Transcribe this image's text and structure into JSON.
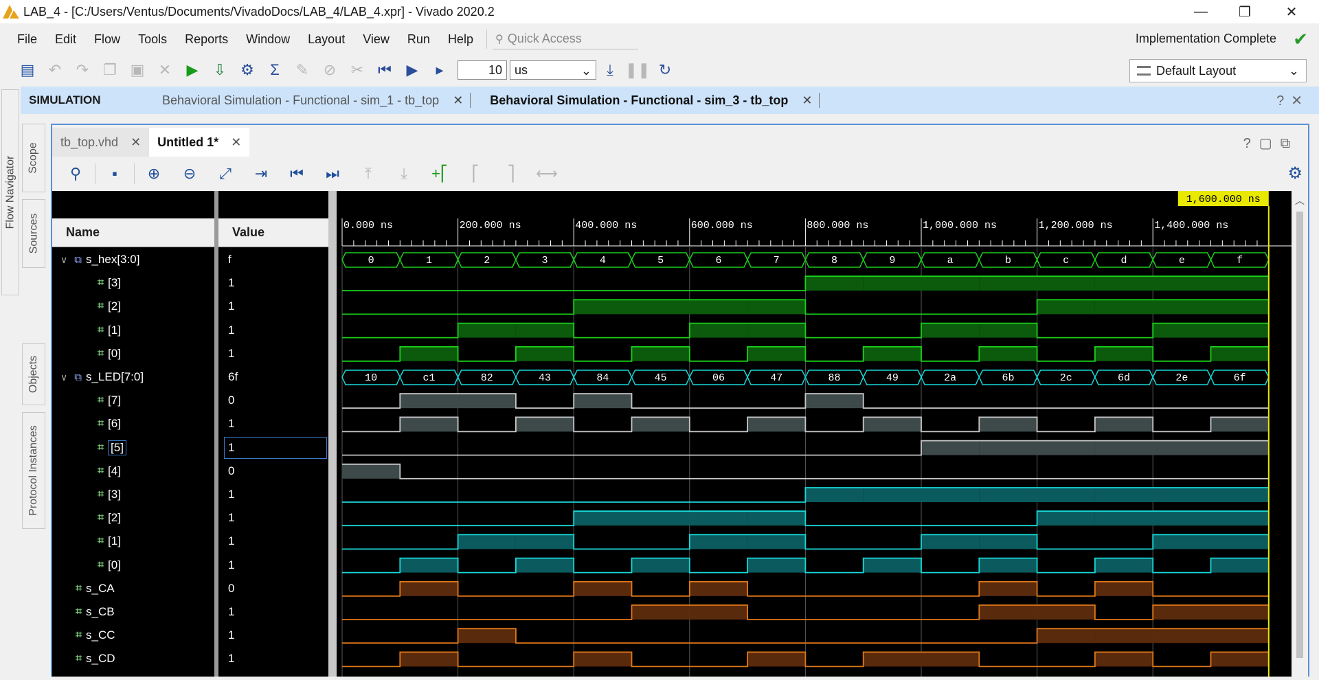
{
  "window": {
    "title": "LAB_4 - [C:/Users/Ventus/Documents/VivadoDocs/LAB_4/LAB_4.xpr] - Vivado 2020.2",
    "minimize": "—",
    "restore": "❐",
    "close": "✕"
  },
  "menu": {
    "items": [
      "File",
      "Edit",
      "Flow",
      "Tools",
      "Reports",
      "Window",
      "Layout",
      "View",
      "Run",
      "Help"
    ],
    "quick_access_placeholder": "Quick Access",
    "status": "Implementation Complete",
    "status_color": "#2a9a2a"
  },
  "toolbar": {
    "run_time_value": "10",
    "run_time_unit": "us",
    "layout": "Default Layout"
  },
  "sim_bar": {
    "label": "SIMULATION",
    "tabs": [
      {
        "label": "Behavioral Simulation - Functional - sim_1 - tb_top",
        "active": false
      },
      {
        "label": "Behavioral Simulation - Functional - sim_3 - tb_top",
        "active": true
      }
    ]
  },
  "side_tabs": {
    "left": [
      "Flow Navigator"
    ],
    "inner": [
      "Scope",
      "Sources",
      "Objects",
      "Protocol Instances"
    ]
  },
  "editor_tabs": [
    {
      "label": "tb_top.vhd",
      "active": false
    },
    {
      "label": "Untitled 1*",
      "active": true
    }
  ],
  "wave": {
    "header_name": "Name",
    "header_value": "Value",
    "cursor_time": "1,600.000 ns",
    "ticks": [
      "0.000 ns",
      "200.000 ns",
      "400.000 ns",
      "600.000 ns",
      "800.000 ns",
      "1,000.000 ns",
      "1,200.000 ns",
      "1,400.000 ns"
    ],
    "colors": {
      "green": "#1ad01a",
      "green_fill": "#0c5a0c",
      "gray": "#c8c8c8",
      "gray_fill": "#3e4a4a",
      "cyan": "#18d8d8",
      "cyan_fill": "#0b5a5e",
      "orange": "#e07818",
      "orange_fill": "#5a2a0c",
      "cursor": "#e8e800"
    },
    "signals": [
      {
        "name": "s_hex[3:0]",
        "value": "f",
        "kind": "bus",
        "level": 0,
        "color": "green",
        "bus_values": [
          "0",
          "1",
          "2",
          "3",
          "4",
          "5",
          "6",
          "7",
          "8",
          "9",
          "a",
          "b",
          "c",
          "d",
          "e",
          "f"
        ]
      },
      {
        "name": "[3]",
        "value": "1",
        "kind": "bit",
        "level": 1,
        "color": "green",
        "bits": [
          0,
          0,
          0,
          0,
          0,
          0,
          0,
          0,
          1,
          1,
          1,
          1,
          1,
          1,
          1,
          1
        ]
      },
      {
        "name": "[2]",
        "value": "1",
        "kind": "bit",
        "level": 1,
        "color": "green",
        "bits": [
          0,
          0,
          0,
          0,
          1,
          1,
          1,
          1,
          0,
          0,
          0,
          0,
          1,
          1,
          1,
          1
        ]
      },
      {
        "name": "[1]",
        "value": "1",
        "kind": "bit",
        "level": 1,
        "color": "green",
        "bits": [
          0,
          0,
          1,
          1,
          0,
          0,
          1,
          1,
          0,
          0,
          1,
          1,
          0,
          0,
          1,
          1
        ]
      },
      {
        "name": "[0]",
        "value": "1",
        "kind": "bit",
        "level": 1,
        "color": "green",
        "bits": [
          0,
          1,
          0,
          1,
          0,
          1,
          0,
          1,
          0,
          1,
          0,
          1,
          0,
          1,
          0,
          1
        ]
      },
      {
        "name": "s_LED[7:0]",
        "value": "6f",
        "kind": "bus",
        "level": 0,
        "color": "cyan",
        "bus_values": [
          "10",
          "c1",
          "82",
          "43",
          "84",
          "45",
          "06",
          "47",
          "88",
          "49",
          "2a",
          "6b",
          "2c",
          "6d",
          "2e",
          "6f"
        ]
      },
      {
        "name": "[7]",
        "value": "0",
        "kind": "bit",
        "level": 1,
        "color": "gray",
        "bits": [
          0,
          1,
          1,
          0,
          1,
          0,
          0,
          0,
          1,
          0,
          0,
          0,
          0,
          0,
          0,
          0
        ]
      },
      {
        "name": "[6]",
        "value": "1",
        "kind": "bit",
        "level": 1,
        "color": "gray",
        "bits": [
          0,
          1,
          0,
          1,
          0,
          1,
          0,
          1,
          0,
          1,
          0,
          1,
          0,
          1,
          0,
          1
        ]
      },
      {
        "name": "[5]",
        "value": "1",
        "kind": "bit",
        "level": 1,
        "color": "gray",
        "selected": true,
        "bits": [
          0,
          0,
          0,
          0,
          0,
          0,
          0,
          0,
          0,
          0,
          1,
          1,
          1,
          1,
          1,
          1
        ]
      },
      {
        "name": "[4]",
        "value": "0",
        "kind": "bit",
        "level": 1,
        "color": "gray",
        "bits": [
          1,
          0,
          0,
          0,
          0,
          0,
          0,
          0,
          0,
          0,
          0,
          0,
          0,
          0,
          0,
          0
        ]
      },
      {
        "name": "[3]",
        "value": "1",
        "kind": "bit",
        "level": 1,
        "color": "cyan",
        "bits": [
          0,
          0,
          0,
          0,
          0,
          0,
          0,
          0,
          1,
          1,
          1,
          1,
          1,
          1,
          1,
          1
        ]
      },
      {
        "name": "[2]",
        "value": "1",
        "kind": "bit",
        "level": 1,
        "color": "cyan",
        "bits": [
          0,
          0,
          0,
          0,
          1,
          1,
          1,
          1,
          0,
          0,
          0,
          0,
          1,
          1,
          1,
          1
        ]
      },
      {
        "name": "[1]",
        "value": "1",
        "kind": "bit",
        "level": 1,
        "color": "cyan",
        "bits": [
          0,
          0,
          1,
          1,
          0,
          0,
          1,
          1,
          0,
          0,
          1,
          1,
          0,
          0,
          1,
          1
        ]
      },
      {
        "name": "[0]",
        "value": "1",
        "kind": "bit",
        "level": 1,
        "color": "cyan",
        "bits": [
          0,
          1,
          0,
          1,
          0,
          1,
          0,
          1,
          0,
          1,
          0,
          1,
          0,
          1,
          0,
          1
        ]
      },
      {
        "name": "s_CA",
        "value": "0",
        "kind": "bit",
        "level": 0,
        "color": "orange",
        "bits": [
          0,
          1,
          0,
          0,
          1,
          0,
          1,
          0,
          0,
          0,
          0,
          1,
          0,
          1,
          0,
          0
        ]
      },
      {
        "name": "s_CB",
        "value": "1",
        "kind": "bit",
        "level": 0,
        "color": "orange",
        "bits": [
          0,
          0,
          0,
          0,
          0,
          1,
          1,
          0,
          0,
          0,
          0,
          1,
          1,
          0,
          1,
          1
        ]
      },
      {
        "name": "s_CC",
        "value": "1",
        "kind": "bit",
        "level": 0,
        "color": "orange",
        "bits": [
          0,
          0,
          1,
          0,
          0,
          0,
          0,
          0,
          0,
          0,
          0,
          0,
          1,
          1,
          1,
          1
        ]
      },
      {
        "name": "s_CD",
        "value": "1",
        "kind": "bit",
        "level": 0,
        "color": "orange",
        "bits": [
          0,
          1,
          0,
          0,
          1,
          0,
          0,
          1,
          0,
          1,
          1,
          0,
          0,
          1,
          0,
          1
        ]
      }
    ]
  }
}
